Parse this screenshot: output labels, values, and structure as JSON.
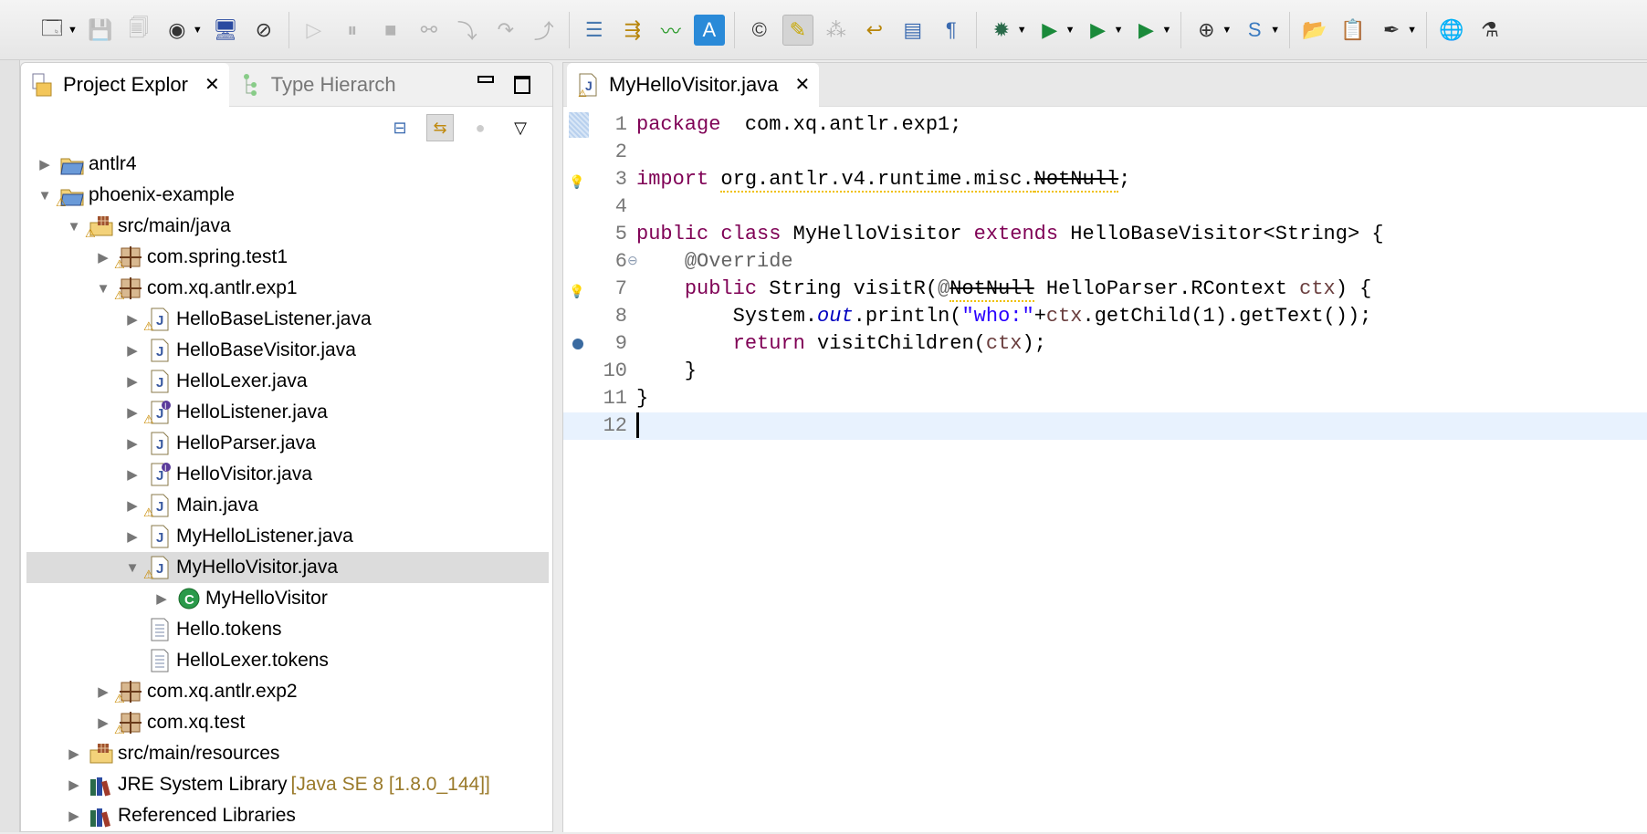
{
  "toolbar": {
    "icons": [
      "new-wizard-icon",
      "save-icon",
      "save-all-icon",
      "user-icon",
      "terminal-icon",
      "skip-breakpoints-icon",
      "resume-icon",
      "suspend-icon",
      "terminate-icon",
      "disconnect-icon",
      "step-into-icon",
      "step-over-icon",
      "step-return-icon",
      "drop-to-frame-icon",
      "use-step-filters-icon",
      "monitor-icon",
      "translate-icon",
      "open-type-icon",
      "highlight-icon",
      "toggle-occurrences-icon",
      "next-annotation-icon",
      "block-selection-icon",
      "show-whitespace-icon",
      "debug-icon",
      "run-icon",
      "coverage-icon",
      "run-external-icon",
      "new-server-icon",
      "new-spring-icon",
      "open-project-icon",
      "open-task-icon",
      "brush-icon",
      "globe-icon",
      "run-as-icon"
    ]
  },
  "explorer": {
    "tabs": [
      {
        "label": "Project Explor",
        "close": "✕"
      },
      {
        "label": "Type Hierarch"
      }
    ],
    "tree": [
      {
        "depth": 0,
        "state": "collapsed",
        "icon": "project",
        "label": "antlr4",
        "warn": false
      },
      {
        "depth": 0,
        "state": "expanded",
        "icon": "project",
        "label": "phoenix-example",
        "warn": true
      },
      {
        "depth": 1,
        "state": "expanded",
        "icon": "srcfolder",
        "label": "src/main/java",
        "warn": true
      },
      {
        "depth": 2,
        "state": "collapsed",
        "icon": "package",
        "label": "com.spring.test1",
        "warn": true
      },
      {
        "depth": 2,
        "state": "expanded",
        "icon": "package",
        "label": "com.xq.antlr.exp1",
        "warn": true
      },
      {
        "depth": 3,
        "state": "collapsed",
        "icon": "java",
        "label": "HelloBaseListener.java",
        "warn": true
      },
      {
        "depth": 3,
        "state": "collapsed",
        "icon": "java",
        "label": "HelloBaseVisitor.java",
        "warn": false
      },
      {
        "depth": 3,
        "state": "collapsed",
        "icon": "java",
        "label": "HelloLexer.java",
        "warn": false
      },
      {
        "depth": 3,
        "state": "collapsed",
        "icon": "interface",
        "label": "HelloListener.java",
        "warn": true
      },
      {
        "depth": 3,
        "state": "collapsed",
        "icon": "java",
        "label": "HelloParser.java",
        "warn": false
      },
      {
        "depth": 3,
        "state": "collapsed",
        "icon": "interface",
        "label": "HelloVisitor.java",
        "warn": false
      },
      {
        "depth": 3,
        "state": "collapsed",
        "icon": "java",
        "label": "Main.java",
        "warn": true
      },
      {
        "depth": 3,
        "state": "collapsed",
        "icon": "java",
        "label": "MyHelloListener.java",
        "warn": false
      },
      {
        "depth": 3,
        "state": "expanded",
        "icon": "java",
        "label": "MyHelloVisitor.java",
        "warn": true,
        "selected": true
      },
      {
        "depth": 4,
        "state": "collapsed",
        "icon": "class",
        "label": "MyHelloVisitor",
        "warn": false
      },
      {
        "depth": 3,
        "state": "none",
        "icon": "file",
        "label": "Hello.tokens",
        "warn": false
      },
      {
        "depth": 3,
        "state": "none",
        "icon": "file",
        "label": "HelloLexer.tokens",
        "warn": false
      },
      {
        "depth": 2,
        "state": "collapsed",
        "icon": "package",
        "label": "com.xq.antlr.exp2",
        "warn": true
      },
      {
        "depth": 2,
        "state": "collapsed",
        "icon": "package",
        "label": "com.xq.test",
        "warn": true
      },
      {
        "depth": 1,
        "state": "collapsed",
        "icon": "srcfolder",
        "label": "src/main/resources",
        "warn": false
      },
      {
        "depth": 1,
        "state": "collapsed",
        "icon": "library",
        "label": "JRE System Library",
        "suffix": "[Java SE 8 [1.8.0_144]]",
        "warn": false
      },
      {
        "depth": 1,
        "state": "collapsed",
        "icon": "library",
        "label": "Referenced Libraries",
        "warn": false
      }
    ]
  },
  "editor": {
    "tab": {
      "label": "MyHelloVisitor.java",
      "close": "✕"
    },
    "lines": [
      {
        "n": "1",
        "marker": "bookmark",
        "tokens": [
          [
            "kw",
            "package"
          ],
          [
            "",
            "  com.xq.antlr.exp1;"
          ]
        ]
      },
      {
        "n": "2",
        "tokens": []
      },
      {
        "n": "3",
        "marker": "warning",
        "tokens": [
          [
            "kw",
            "import"
          ],
          [
            "",
            " "
          ],
          [
            "squig",
            "org.antlr.v4.runtime.misc."
          ],
          [
            "squig strike",
            "NotNull"
          ],
          [
            "",
            ";"
          ]
        ]
      },
      {
        "n": "4",
        "tokens": []
      },
      {
        "n": "5",
        "tokens": [
          [
            "kw",
            "public"
          ],
          [
            "",
            " "
          ],
          [
            "kw",
            "class"
          ],
          [
            "",
            " MyHelloVisitor "
          ],
          [
            "kw",
            "extends"
          ],
          [
            "",
            " HelloBaseVisitor<String> {"
          ]
        ]
      },
      {
        "n": "6",
        "fold": true,
        "tokens": [
          [
            "",
            "    "
          ],
          [
            "ann",
            "@Override"
          ]
        ]
      },
      {
        "n": "7",
        "marker": "warning",
        "tokens": [
          [
            "",
            "    "
          ],
          [
            "kw",
            "public"
          ],
          [
            "",
            " String visitR("
          ],
          [
            "ann",
            "@"
          ],
          [
            "squig strike",
            "NotNull"
          ],
          [
            "",
            " HelloParser.RContext "
          ],
          [
            "var",
            "ctx"
          ],
          [
            "",
            ") {"
          ]
        ]
      },
      {
        "n": "8",
        "tokens": [
          [
            "",
            "        System."
          ],
          [
            "ital",
            "out"
          ],
          [
            "",
            ".println("
          ],
          [
            "str",
            "\"who:\""
          ],
          [
            "",
            "+"
          ],
          [
            "var",
            "ctx"
          ],
          [
            "",
            ".getChild(1).getText());"
          ]
        ]
      },
      {
        "n": "9",
        "marker": "breakpoint",
        "tokens": [
          [
            "",
            "        "
          ],
          [
            "kw",
            "return"
          ],
          [
            "",
            " visitChildren("
          ],
          [
            "var",
            "ctx"
          ],
          [
            "",
            ");"
          ]
        ]
      },
      {
        "n": "10",
        "tokens": [
          [
            "",
            "    }"
          ]
        ]
      },
      {
        "n": "11",
        "tokens": [
          [
            "",
            "}"
          ]
        ]
      },
      {
        "n": "12",
        "current": true,
        "tokens": []
      }
    ]
  }
}
